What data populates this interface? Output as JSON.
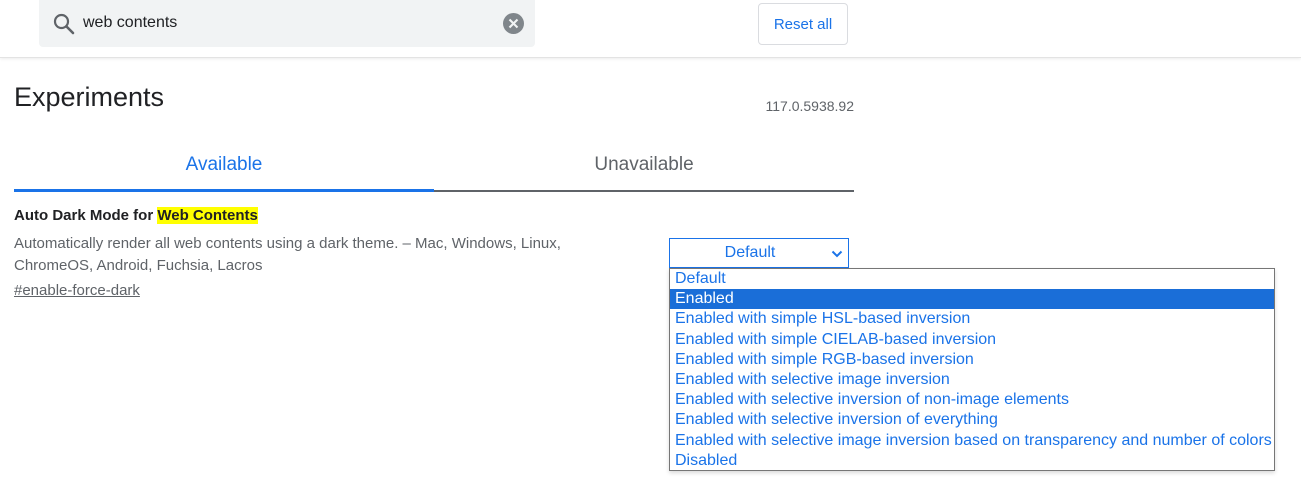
{
  "search": {
    "value": "web contents",
    "icon": "search-icon",
    "clear_icon": "clear-icon"
  },
  "header": {
    "reset_label": "Reset all"
  },
  "page": {
    "title": "Experiments",
    "version": "117.0.5938.92"
  },
  "tabs": [
    {
      "label": "Available",
      "active": true
    },
    {
      "label": "Unavailable",
      "active": false
    }
  ],
  "experiment": {
    "title_prefix": "Auto Dark Mode for ",
    "title_highlight": "Web Contents",
    "description_line1": "Automatically render all web contents using a dark theme. – Mac, Windows, Linux,",
    "description_line2": "ChromeOS, Android, Fuchsia, Lacros",
    "link": "#enable-force-dark",
    "selected_value": "Default",
    "options": [
      "Default",
      "Enabled",
      "Enabled with simple HSL-based inversion",
      "Enabled with simple CIELAB-based inversion",
      "Enabled with simple RGB-based inversion",
      "Enabled with selective image inversion",
      "Enabled with selective inversion of non-image elements",
      "Enabled with selective inversion of everything",
      "Enabled with selective image inversion based on transparency and number of colors",
      "Disabled"
    ],
    "highlighted_option_index": 1
  },
  "colors": {
    "accent": "#1a73e8",
    "highlight": "#ffff00",
    "selected_option_bg": "#1a6ed8"
  }
}
